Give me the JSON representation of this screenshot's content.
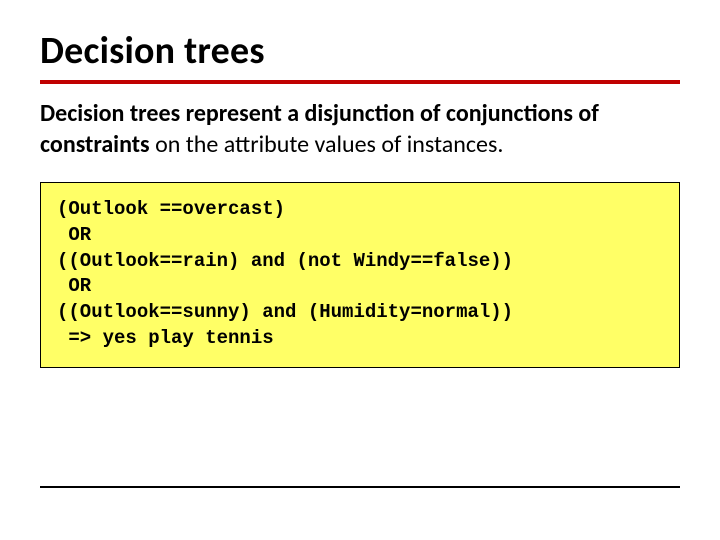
{
  "title": "Decision trees",
  "body": {
    "lead": "Decision trees represent a disjunction of conjunctions of constraints",
    "rest": " on the attribute values of instances."
  },
  "code": {
    "l1": "(Outlook ==overcast)",
    "l2": " OR",
    "l3": "((Outlook==rain) and (not Windy==false))",
    "l4": " OR",
    "l5": "((Outlook==sunny) and (Humidity=normal))",
    "l6": " => yes play tennis"
  }
}
